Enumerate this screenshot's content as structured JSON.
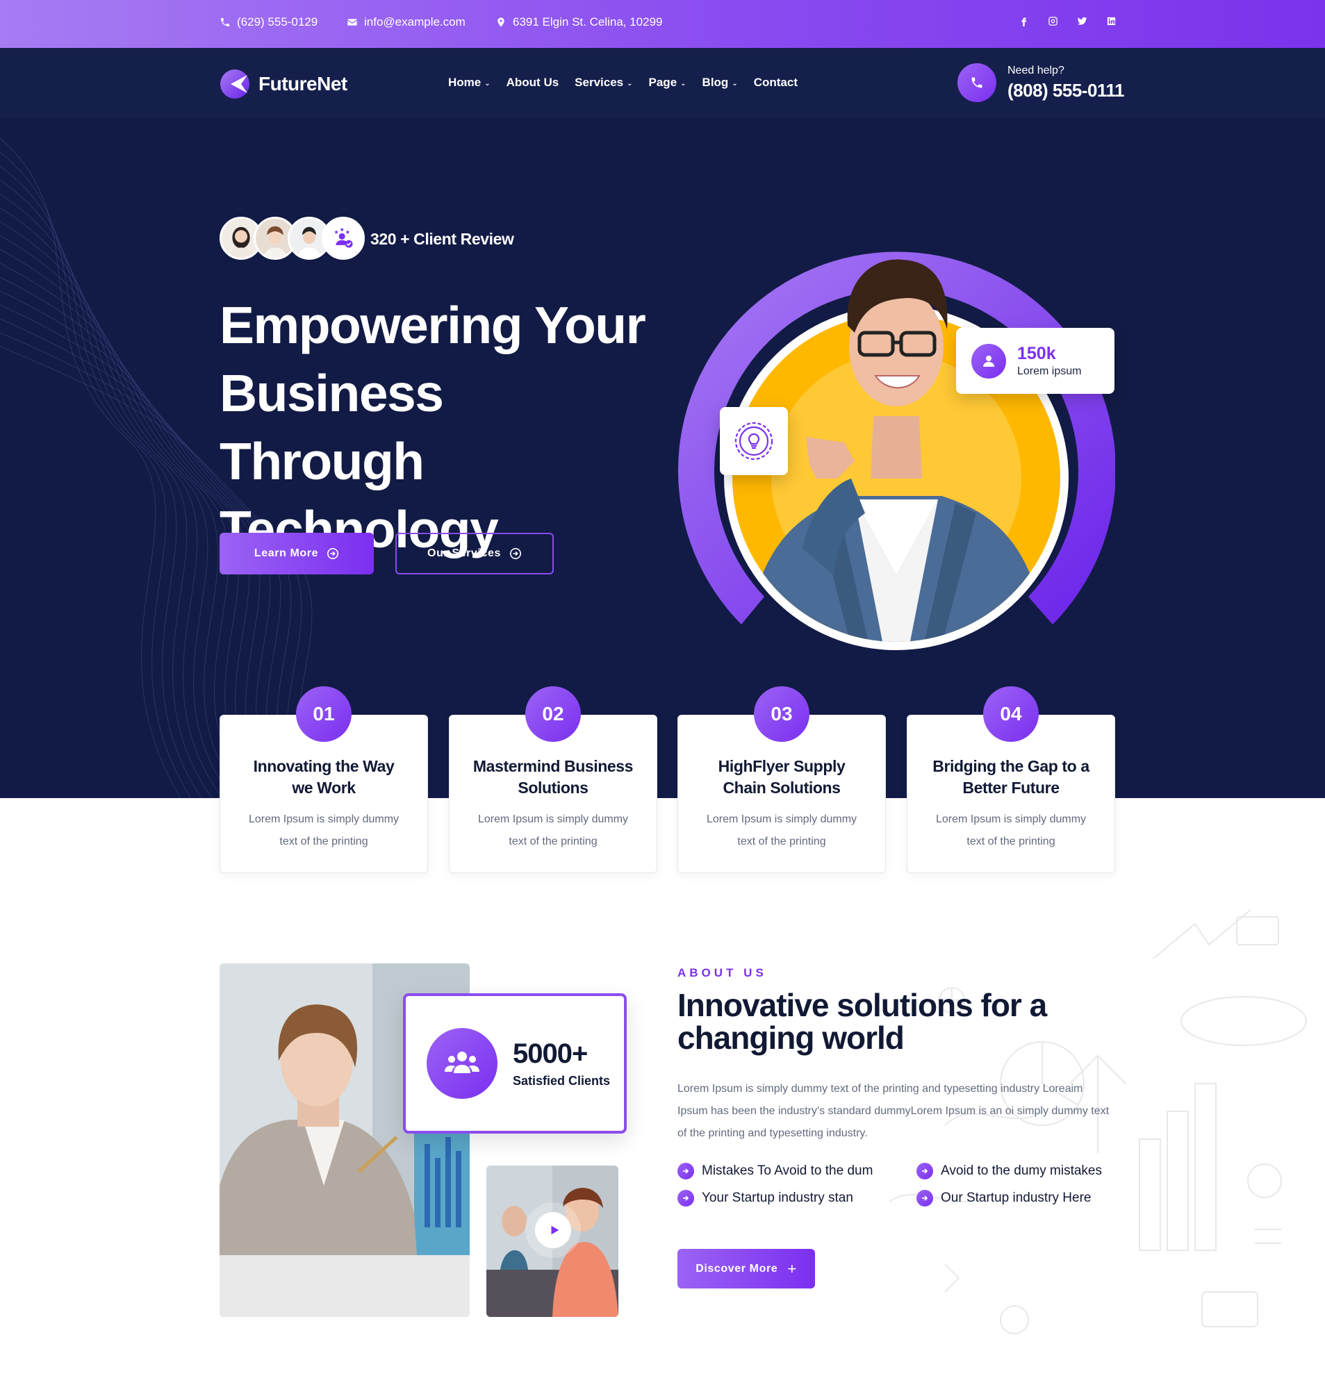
{
  "topbar": {
    "phone": "(629) 555-0129",
    "email": "info@example.com",
    "address": "6391 Elgin St. Celina, 10299",
    "social": [
      "facebook-icon",
      "instagram-icon",
      "twitter-icon",
      "linkedin-icon"
    ]
  },
  "nav": {
    "logo": "FutureNet",
    "items": [
      {
        "label": "Home",
        "dropdown": true
      },
      {
        "label": "About Us",
        "dropdown": false
      },
      {
        "label": "Services",
        "dropdown": true
      },
      {
        "label": "Page",
        "dropdown": true
      },
      {
        "label": "Blog",
        "dropdown": true
      },
      {
        "label": "Contact",
        "dropdown": false
      }
    ],
    "help_label": "Need help?",
    "help_phone": "(808) 555-0111"
  },
  "hero": {
    "reviews": "320 +  Client Review",
    "headline_1": "Empowering Your",
    "headline_2": "Business Through",
    "headline_3": "Technology",
    "btn_learn": "Learn More",
    "btn_services": "Our Services",
    "stat_value": "150k",
    "stat_label": "Lorem ipsum"
  },
  "features": [
    {
      "num": "01",
      "title_1": "Innovating the Way",
      "title_2": "we Work",
      "desc_1": "Lorem Ipsum is simply dummy",
      "desc_2": "text of the printing"
    },
    {
      "num": "02",
      "title_1": "Mastermind Business",
      "title_2": "Solutions",
      "desc_1": "Lorem Ipsum is simply dummy",
      "desc_2": "text of the printing"
    },
    {
      "num": "03",
      "title_1": "HighFlyer Supply",
      "title_2": "Chain Solutions",
      "desc_1": "Lorem Ipsum is simply dummy",
      "desc_2": "text of the printing"
    },
    {
      "num": "04",
      "title_1": "Bridging the Gap to a",
      "title_2": "Better Future",
      "desc_1": "Lorem Ipsum is simply dummy",
      "desc_2": "text of the printing"
    }
  ],
  "about": {
    "eyebrow": "ABOUT US",
    "title_1": "Innovative solutions for a",
    "title_2": "changing world",
    "text": "Lorem Ipsum is simply dummy text of the printing and typesetting industry Loreaim Ipsum has been the industry's standard dummyLorem Ipsum is an oi simply dummy text of the printing and typesetting industry.",
    "clients_value": "5000+",
    "clients_label": "Satisfied Clients",
    "checks": [
      "Mistakes To Avoid to the dum",
      "Avoid to the dumy mistakes",
      "Your Startup industry stan",
      "Our Startup industry Here"
    ],
    "btn_discover": "Discover More"
  },
  "colors": {
    "primary": "#7b2ff0",
    "primary_light": "#9b63f5",
    "navy": "#121b45",
    "accent_yellow": "#ffb800"
  }
}
